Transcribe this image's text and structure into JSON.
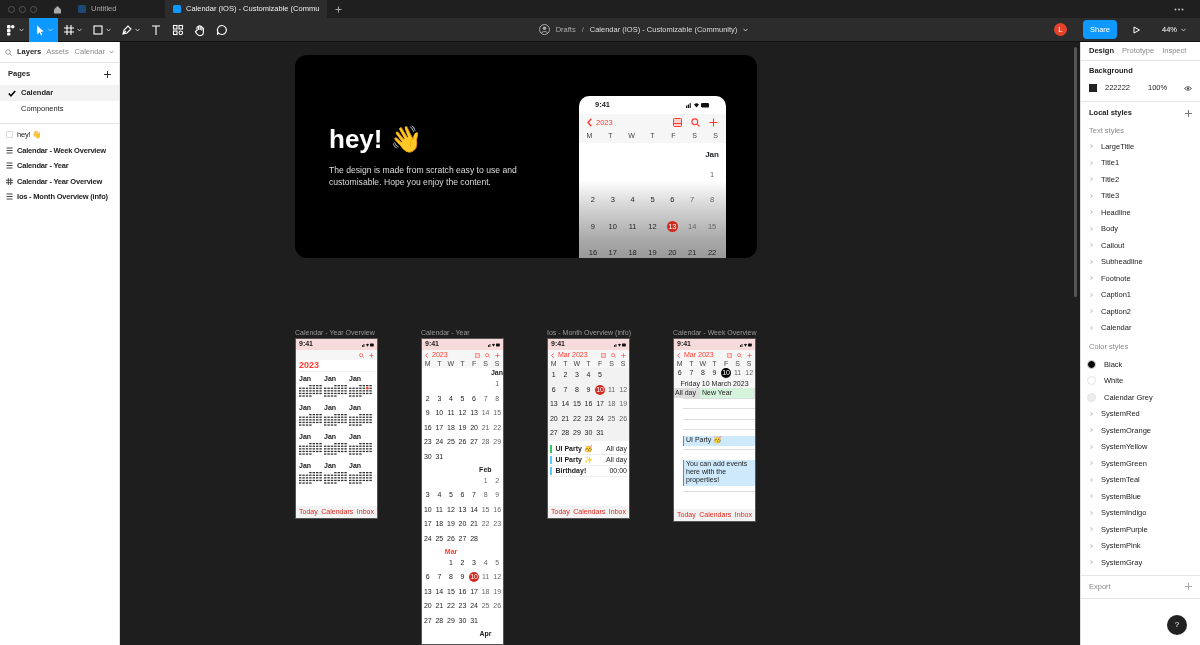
{
  "browser_tabs": [
    {
      "label": "Untitled",
      "selected": false
    },
    {
      "label": "Calendar (IOS) - Customizable (Commu",
      "selected": true
    }
  ],
  "toolbar": {
    "tools": [
      {
        "kind": "main-menu",
        "has_menu": true,
        "selected": false
      },
      {
        "kind": "move",
        "has_menu": true,
        "selected": true
      },
      {
        "kind": "frame",
        "has_menu": true,
        "selected": false
      },
      {
        "kind": "shape",
        "has_menu": true,
        "selected": false
      },
      {
        "kind": "pen",
        "has_menu": true,
        "selected": false
      },
      {
        "kind": "text",
        "has_menu": false,
        "selected": false
      },
      {
        "kind": "resources",
        "has_menu": false,
        "selected": false
      },
      {
        "kind": "hand",
        "has_menu": false,
        "selected": false
      },
      {
        "kind": "comment",
        "has_menu": false,
        "selected": false
      }
    ],
    "folder": "Drafts",
    "separator": "/",
    "file": "Calendar (IOS) - Customizable (Community)",
    "user_initial": "L",
    "share": "Share",
    "zoom": "44%"
  },
  "left_panel": {
    "tabs": [
      {
        "label": "Layers",
        "selected": true
      },
      {
        "label": "Assets",
        "selected": false
      }
    ],
    "page_picker": "Calendar",
    "pages_title": "Pages",
    "pages": [
      {
        "label": "Calendar",
        "selected": true
      },
      {
        "label": "Components",
        "selected": false
      }
    ],
    "layers": [
      {
        "label": "hey! 👋",
        "kind": "hidden"
      },
      {
        "label": "Calendar - Week Overview",
        "kind": "list"
      },
      {
        "label": "Calendar - Year",
        "kind": "list"
      },
      {
        "label": "Calendar - Year Overview",
        "kind": "grid"
      },
      {
        "label": "Ios - Month Overview (info)",
        "kind": "list"
      }
    ]
  },
  "canvas": {
    "hero": {
      "title": "hey! 👋",
      "text": "The design is made from scratch easy to use and customisable. Hope you enjoy the content.",
      "phone": {
        "time": "9:41",
        "back": "2023",
        "weekdays": [
          "M",
          "T",
          "W",
          "T",
          "F",
          "S",
          "S"
        ],
        "month": "Jan",
        "weeks": [
          [
            {
              "d": "1",
              "today": false
            }
          ],
          [
            {
              "d": "2",
              "today": false
            },
            {
              "d": "3",
              "today": false
            },
            {
              "d": "4",
              "today": false
            },
            {
              "d": "5",
              "today": false
            },
            {
              "d": "6",
              "today": false
            },
            {
              "d": "7",
              "today": false
            },
            {
              "d": "8",
              "today": false
            }
          ],
          [
            {
              "d": "9",
              "today": false
            },
            {
              "d": "10",
              "today": false
            },
            {
              "d": "11",
              "today": false
            },
            {
              "d": "12",
              "today": false
            },
            {
              "d": "13",
              "today": true
            },
            {
              "d": "14",
              "today": false
            },
            {
              "d": "15",
              "today": false
            }
          ],
          [
            {
              "d": "16",
              "today": false
            },
            {
              "d": "17",
              "today": false
            },
            {
              "d": "18",
              "today": false
            },
            {
              "d": "19",
              "today": false
            },
            {
              "d": "20",
              "today": false
            },
            {
              "d": "21",
              "today": false
            },
            {
              "d": "22",
              "today": false
            }
          ]
        ]
      }
    },
    "frames": [
      {
        "kind": "year-overview",
        "title": "Calendar - Year Overview",
        "time": "9:41",
        "year": "2023",
        "months": [
          "Jan",
          "Jan",
          "Jan",
          "Jan",
          "Jan",
          "Jan",
          "Jan",
          "Jan",
          "Jan",
          "Jan",
          "Jan",
          "Jan"
        ],
        "tabbar": [
          "Today",
          "Calendars",
          "Inbox"
        ]
      },
      {
        "kind": "year",
        "title": "Calendar - Year",
        "time": "9:41",
        "back": "2023",
        "weekdays": [
          "M",
          "T",
          "W",
          "T",
          "F",
          "S",
          "S"
        ],
        "months": [
          {
            "name": "Jan",
            "weeks": [
              [
                {
                  "d": "1",
                  "today": false
                }
              ],
              [
                {
                  "d": "2",
                  "today": false
                },
                {
                  "d": "3",
                  "today": false
                },
                {
                  "d": "4",
                  "today": false
                },
                {
                  "d": "5",
                  "today": false
                },
                {
                  "d": "6",
                  "today": false
                },
                {
                  "d": "7",
                  "today": false
                },
                {
                  "d": "8",
                  "today": false
                }
              ],
              [
                {
                  "d": "9",
                  "today": false
                },
                {
                  "d": "10",
                  "today": false
                },
                {
                  "d": "11",
                  "today": false
                },
                {
                  "d": "12",
                  "today": false
                },
                {
                  "d": "13",
                  "today": false
                },
                {
                  "d": "14",
                  "today": false
                },
                {
                  "d": "15",
                  "today": false
                }
              ],
              [
                {
                  "d": "16",
                  "today": false
                },
                {
                  "d": "17",
                  "today": false
                },
                {
                  "d": "18",
                  "today": false
                },
                {
                  "d": "19",
                  "today": false
                },
                {
                  "d": "20",
                  "today": false
                },
                {
                  "d": "21",
                  "today": false
                },
                {
                  "d": "22",
                  "today": false
                }
              ],
              [
                {
                  "d": "23",
                  "today": false
                },
                {
                  "d": "24",
                  "today": false
                },
                {
                  "d": "25",
                  "today": false
                },
                {
                  "d": "26",
                  "today": false
                },
                {
                  "d": "27",
                  "today": false
                },
                {
                  "d": "28",
                  "today": false
                },
                {
                  "d": "29",
                  "today": false
                }
              ],
              [
                {
                  "d": "30",
                  "today": false
                },
                {
                  "d": "31",
                  "today": false
                }
              ]
            ]
          },
          {
            "name": "Feb",
            "weeks": [
              [
                {
                  "d": "1",
                  "today": false
                },
                {
                  "d": "2",
                  "today": false
                }
              ],
              [
                {
                  "d": "3",
                  "today": false
                },
                {
                  "d": "4",
                  "today": false
                },
                {
                  "d": "5",
                  "today": false
                },
                {
                  "d": "6",
                  "today": false
                },
                {
                  "d": "7",
                  "today": false
                },
                {
                  "d": "8",
                  "today": false
                },
                {
                  "d": "9",
                  "today": false
                }
              ],
              [
                {
                  "d": "10",
                  "today": false
                },
                {
                  "d": "11",
                  "today": false
                },
                {
                  "d": "12",
                  "today": false
                },
                {
                  "d": "13",
                  "today": false
                },
                {
                  "d": "14",
                  "today": false
                },
                {
                  "d": "15",
                  "today": false
                },
                {
                  "d": "16",
                  "today": false
                }
              ],
              [
                {
                  "d": "17",
                  "today": false
                },
                {
                  "d": "18",
                  "today": false
                },
                {
                  "d": "19",
                  "today": false
                },
                {
                  "d": "20",
                  "today": false
                },
                {
                  "d": "21",
                  "today": false
                },
                {
                  "d": "22",
                  "today": false
                },
                {
                  "d": "23",
                  "today": false
                }
              ],
              [
                {
                  "d": "24",
                  "today": false
                },
                {
                  "d": "25",
                  "today": false
                },
                {
                  "d": "26",
                  "today": false
                },
                {
                  "d": "27",
                  "today": false
                },
                {
                  "d": "28",
                  "today": false
                }
              ]
            ]
          },
          {
            "name": "Mar",
            "weeks": [
              [
                {
                  "d": "1",
                  "today": false
                },
                {
                  "d": "2",
                  "today": false
                },
                {
                  "d": "3",
                  "today": false
                },
                {
                  "d": "4",
                  "today": false
                },
                {
                  "d": "5",
                  "today": false
                }
              ],
              [
                {
                  "d": "6",
                  "today": false
                },
                {
                  "d": "7",
                  "today": false
                },
                {
                  "d": "8",
                  "today": false
                },
                {
                  "d": "9",
                  "today": false
                },
                {
                  "d": "10",
                  "today": true
                },
                {
                  "d": "11",
                  "today": false
                },
                {
                  "d": "12",
                  "today": false
                }
              ],
              [
                {
                  "d": "13",
                  "today": false
                },
                {
                  "d": "14",
                  "today": false
                },
                {
                  "d": "15",
                  "today": false
                },
                {
                  "d": "16",
                  "today": false
                },
                {
                  "d": "17",
                  "today": false
                },
                {
                  "d": "18",
                  "today": false
                },
                {
                  "d": "19",
                  "today": false
                }
              ],
              [
                {
                  "d": "20",
                  "today": false
                },
                {
                  "d": "21",
                  "today": false
                },
                {
                  "d": "22",
                  "today": false
                },
                {
                  "d": "23",
                  "today": false
                },
                {
                  "d": "24",
                  "today": false
                },
                {
                  "d": "25",
                  "today": false
                },
                {
                  "d": "26",
                  "today": false
                }
              ],
              [
                {
                  "d": "27",
                  "today": false
                },
                {
                  "d": "28",
                  "today": false
                },
                {
                  "d": "29",
                  "today": false
                },
                {
                  "d": "30",
                  "today": false
                },
                {
                  "d": "31",
                  "today": false
                }
              ]
            ]
          },
          {
            "name": "Apr"
          }
        ]
      },
      {
        "kind": "month",
        "title": "Ios - Month Overview (info)",
        "time": "9:41",
        "back": "Mar 2023",
        "weekdays": [
          "M",
          "T",
          "W",
          "T",
          "F",
          "S",
          "S"
        ],
        "weeks": [
          [
            {
              "d": "1",
              "today": false
            },
            {
              "d": "2",
              "today": false
            },
            {
              "d": "3",
              "today": false
            },
            {
              "d": "4",
              "today": false
            },
            {
              "d": "5",
              "today": false
            }
          ],
          [
            {
              "d": "6",
              "today": false
            },
            {
              "d": "7",
              "today": false
            },
            {
              "d": "8",
              "today": false
            },
            {
              "d": "9",
              "today": false
            },
            {
              "d": "10",
              "today": true
            },
            {
              "d": "11",
              "today": false
            },
            {
              "d": "12",
              "today": false
            }
          ],
          [
            {
              "d": "13",
              "today": false
            },
            {
              "d": "14",
              "today": false
            },
            {
              "d": "15",
              "today": false
            },
            {
              "d": "16",
              "today": false
            },
            {
              "d": "17",
              "today": false
            },
            {
              "d": "18",
              "today": false
            },
            {
              "d": "19",
              "today": false
            }
          ],
          [
            {
              "d": "20",
              "today": false
            },
            {
              "d": "21",
              "today": false
            },
            {
              "d": "22",
              "today": false
            },
            {
              "d": "23",
              "today": false
            },
            {
              "d": "24",
              "today": false
            },
            {
              "d": "25",
              "today": false
            },
            {
              "d": "26",
              "today": false
            }
          ],
          [
            {
              "d": "27",
              "today": false
            },
            {
              "d": "28",
              "today": false
            },
            {
              "d": "29",
              "today": false
            },
            {
              "d": "30",
              "today": false
            },
            {
              "d": "31",
              "today": false
            }
          ]
        ],
        "events": [
          {
            "title": "UI Party 🥳",
            "time": "All day",
            "color": "#34c759"
          },
          {
            "title": "UI Party ✨",
            "time": "All day",
            "color": "#5ac8fa"
          },
          {
            "title": "Birthday!",
            "time": "00:00",
            "color": "#5ac8fa"
          }
        ],
        "tabbar": [
          "Today",
          "Calendars",
          "Inbox"
        ]
      },
      {
        "kind": "week",
        "title": "Calendar - Week Overview",
        "time": "9:41",
        "back": "Mar 2023",
        "weekdays": [
          "M",
          "T",
          "W",
          "T",
          "F",
          "S",
          "S"
        ],
        "days": [
          {
            "d": "6",
            "selected": false
          },
          {
            "d": "7",
            "selected": false
          },
          {
            "d": "8",
            "selected": false
          },
          {
            "d": "9",
            "selected": false
          },
          {
            "d": "10",
            "selected": true
          },
          {
            "d": "11",
            "selected": false
          },
          {
            "d": "12",
            "selected": false
          }
        ],
        "date_title": "Friday 10 March 2023",
        "all_day_label": "All day",
        "all_day_event": "New Year",
        "events": [
          {
            "title": "UI Party 🥳"
          },
          {
            "title": "You can add events here with the properties!"
          }
        ],
        "tabbar": [
          "Today",
          "Calendars",
          "Inbox"
        ]
      }
    ]
  },
  "right_panel": {
    "tabs": [
      {
        "label": "Design",
        "selected": true
      },
      {
        "label": "Prototype",
        "selected": false
      },
      {
        "label": "Inspect",
        "selected": false
      }
    ],
    "background_title": "Background",
    "background_hex": "222222",
    "background_opacity": "100%",
    "local_styles_title": "Local styles",
    "text_styles_title": "Text styles",
    "text_styles": [
      "LargeTitle",
      "Title1",
      "Title2",
      "Title3",
      "Headline",
      "Body",
      "Callout",
      "Subheadline",
      "Footnote",
      "Caption1",
      "Caption2",
      "Calendar"
    ],
    "color_styles_title": "Color styles",
    "color_styles": [
      {
        "label": "Black",
        "kind": "swatch",
        "color": "#000000"
      },
      {
        "label": "White",
        "kind": "swatch",
        "color": "#ffffff"
      },
      {
        "label": "Calendar Grey",
        "kind": "swatch",
        "color": "#eeeeee"
      },
      {
        "label": "SystemRed",
        "kind": "group"
      },
      {
        "label": "SystemOrange",
        "kind": "group"
      },
      {
        "label": "SystemYellow",
        "kind": "group"
      },
      {
        "label": "SystemGreen",
        "kind": "group"
      },
      {
        "label": "SystemTeal",
        "kind": "group"
      },
      {
        "label": "SystemBlue",
        "kind": "group"
      },
      {
        "label": "SystemIndigo",
        "kind": "group"
      },
      {
        "label": "SystemPurple",
        "kind": "group"
      },
      {
        "label": "SystemPink",
        "kind": "group"
      },
      {
        "label": "SystemGray",
        "kind": "group"
      }
    ],
    "export_title": "Export",
    "help": "?"
  }
}
